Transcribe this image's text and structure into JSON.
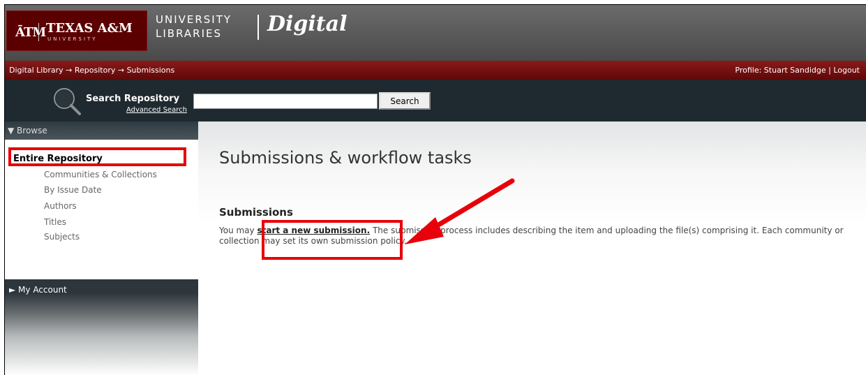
{
  "banner": {
    "logo_atm": "ĀTM",
    "logo_main": "TEXAS A&M",
    "logo_sub": "UNIVERSITY",
    "lib_line1": "UNIVERSITY",
    "lib_line2": "LIBRARIES",
    "lib_digital": "Digital"
  },
  "trail": {
    "items": [
      "Digital Library",
      "Repository",
      "Submissions"
    ],
    "separator": "→"
  },
  "user": {
    "profile": "Profile: Stuart Sandidge",
    "divider": "|",
    "logout": "Logout"
  },
  "search": {
    "title": "Search Repository",
    "advanced": "Advanced Search",
    "value": "",
    "button": "Search"
  },
  "sidebar": {
    "browse_header": "▼ Browse",
    "entire_repository": "Entire Repository",
    "items": [
      "Communities & Collections",
      "By Issue Date",
      "Authors",
      "Titles",
      "Subjects"
    ],
    "account_header": "► My Account"
  },
  "main": {
    "title": "Submissions & workflow tasks",
    "section": "Submissions",
    "para_prefix": "You may ",
    "link": "start a new submission.",
    "para_suffix": " The submission process includes describing the item and uploading the file(s) comprising it. Each community or collection may set its own submission policy."
  },
  "colors": {
    "maroon": "#5e0808",
    "highlight": "#e8000a",
    "dark_bar": "#1f2a30"
  }
}
